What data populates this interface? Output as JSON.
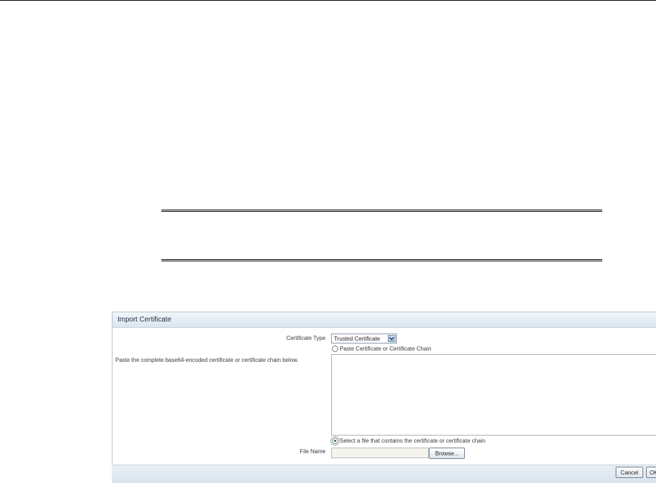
{
  "dialog": {
    "title": "Import Certificate",
    "certificate_type_label": "Certificate Type",
    "certificate_type_value": "Trusted Certificate",
    "paste_option_label": "Paste Certificate or Certificate Chain",
    "paste_instructions": "Paste the complete base64-encoded certificate or certificate chain below.",
    "file_option_label": "Select a file that contains the certificate or certificate chain",
    "file_name_label": "File Name",
    "browse_label": "Browse...",
    "cancel_label": "Cancel",
    "ok_label": "OK"
  }
}
